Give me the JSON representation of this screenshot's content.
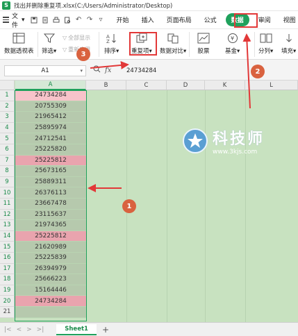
{
  "window": {
    "title": "找出并删除重复项.xlsx(C:/Users/Administrator/Desktop)",
    "app_logo": "S"
  },
  "menubar": {
    "file_label": "文件",
    "tabs": [
      "开始",
      "插入",
      "页面布局",
      "公式",
      "数据",
      "审阅",
      "视图"
    ],
    "active_tab": "数据"
  },
  "ribbon": {
    "pivot_label": "数据透视表",
    "filter_label": "筛选",
    "show_all_label": "全部显示",
    "reapply_label": "重新应用",
    "sort_label": "排序",
    "duplicates_label": "重复项",
    "compare_label": "数据对比",
    "stocks_label": "股票",
    "fund_label": "基金",
    "split_label": "分列",
    "fill_label": "填充"
  },
  "formula_bar": {
    "cell_ref": "A1",
    "fx_label": "fx",
    "value": "24734284"
  },
  "grid": {
    "columns": [
      "A",
      "B",
      "C",
      "D",
      "K",
      "L"
    ],
    "rows": [
      {
        "n": "1",
        "v": "24734284",
        "dup": true
      },
      {
        "n": "2",
        "v": "20755309",
        "dup": false
      },
      {
        "n": "3",
        "v": "21965412",
        "dup": false
      },
      {
        "n": "4",
        "v": "25895974",
        "dup": false
      },
      {
        "n": "5",
        "v": "24712541",
        "dup": false
      },
      {
        "n": "6",
        "v": "25225820",
        "dup": false
      },
      {
        "n": "7",
        "v": "25225812",
        "dup": true
      },
      {
        "n": "8",
        "v": "25673165",
        "dup": false
      },
      {
        "n": "9",
        "v": "25889311",
        "dup": false
      },
      {
        "n": "10",
        "v": "26376113",
        "dup": false
      },
      {
        "n": "11",
        "v": "23667478",
        "dup": false
      },
      {
        "n": "12",
        "v": "23115637",
        "dup": false
      },
      {
        "n": "13",
        "v": "21974365",
        "dup": false
      },
      {
        "n": "14",
        "v": "25225812",
        "dup": true
      },
      {
        "n": "15",
        "v": "21620989",
        "dup": false
      },
      {
        "n": "16",
        "v": "25225839",
        "dup": false
      },
      {
        "n": "17",
        "v": "26394979",
        "dup": false
      },
      {
        "n": "18",
        "v": "25666223",
        "dup": false
      },
      {
        "n": "19",
        "v": "15164446",
        "dup": false
      },
      {
        "n": "20",
        "v": "24734284",
        "dup": true
      },
      {
        "n": "21",
        "v": "",
        "dup": false
      }
    ]
  },
  "watermark": {
    "name": "科技师",
    "url": "www.3kjs.com"
  },
  "annotations": {
    "step1": "1",
    "step2": "2",
    "step3": "3"
  },
  "sheets": {
    "nav": [
      "|<",
      "<",
      ">",
      ">|"
    ],
    "active": "Sheet1",
    "add": "+"
  },
  "colors": {
    "accent": "#1fa15c",
    "duplicate": "#e9a4ae",
    "annotation": "#d9623f",
    "highlight_box": "#e23838"
  }
}
